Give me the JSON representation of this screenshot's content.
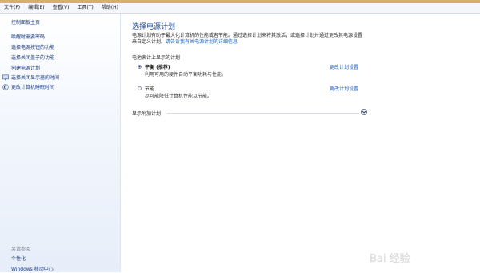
{
  "menubar": {
    "items": [
      "文件(F)",
      "编辑(E)",
      "查看(V)",
      "工具(T)",
      "帮助(H)"
    ]
  },
  "sidebar": {
    "home": "控制面板主页",
    "links": [
      "唤醒时需要密码",
      "选择电源按钮的功能",
      "选择关闭盖子的功能",
      "创建电源计划",
      "选择关闭显示器的时间",
      "更改计算机睡眠时间"
    ],
    "see_also_title": "另请参阅",
    "see_also": [
      "个性化",
      "Windows 移动中心"
    ]
  },
  "main": {
    "title": "选择电源计划",
    "intro_line1": "电源计划有助于最大化计算机的性能或者节能。通过选择计划来将其激活，或选择计划并通过更改其电源设置",
    "intro_line2_prefix": "来自定义计划。",
    "intro_link": "请告诉我有关电源计划的详细信息",
    "group_title": "电池表计上显示的计划",
    "plans": [
      {
        "name": "平衡 (推荐)",
        "description": "利用可用的硬件自动平衡功耗与性能。",
        "link": "更改计划设置",
        "selected": true
      },
      {
        "name": "节能",
        "description": "尽可能降低计算机性能以节能。",
        "link": "更改计划设置",
        "selected": false
      }
    ],
    "more_plans": "显示附加计划"
  },
  "watermark": {
    "text": "Bai 经验"
  },
  "colors": {
    "link": "#1a5fc8",
    "title": "#1d4e9f",
    "sidebar_link": "#1b3c86"
  }
}
